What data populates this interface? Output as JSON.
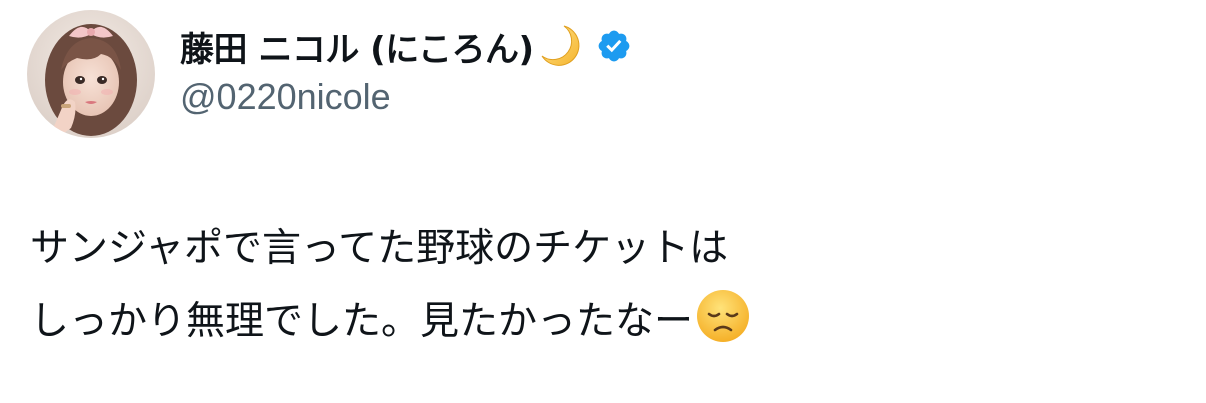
{
  "author": {
    "display_name": "藤田 ニコル (にころん)",
    "handle": "@0220nicole",
    "name_emoji": "crescent-moon-icon",
    "verified_icon": "verified-badge-icon",
    "verified_color": "#1d9bf0",
    "avatar": "profile-photo-avatar"
  },
  "tweet": {
    "line1": "サンジャポで言ってた野球のチケットは",
    "line2": "しっかり無理でした。見たかったなー",
    "trailing_emoji": "disappointed-face-icon"
  },
  "colors": {
    "text": "#0f1419",
    "secondary": "#536471"
  }
}
